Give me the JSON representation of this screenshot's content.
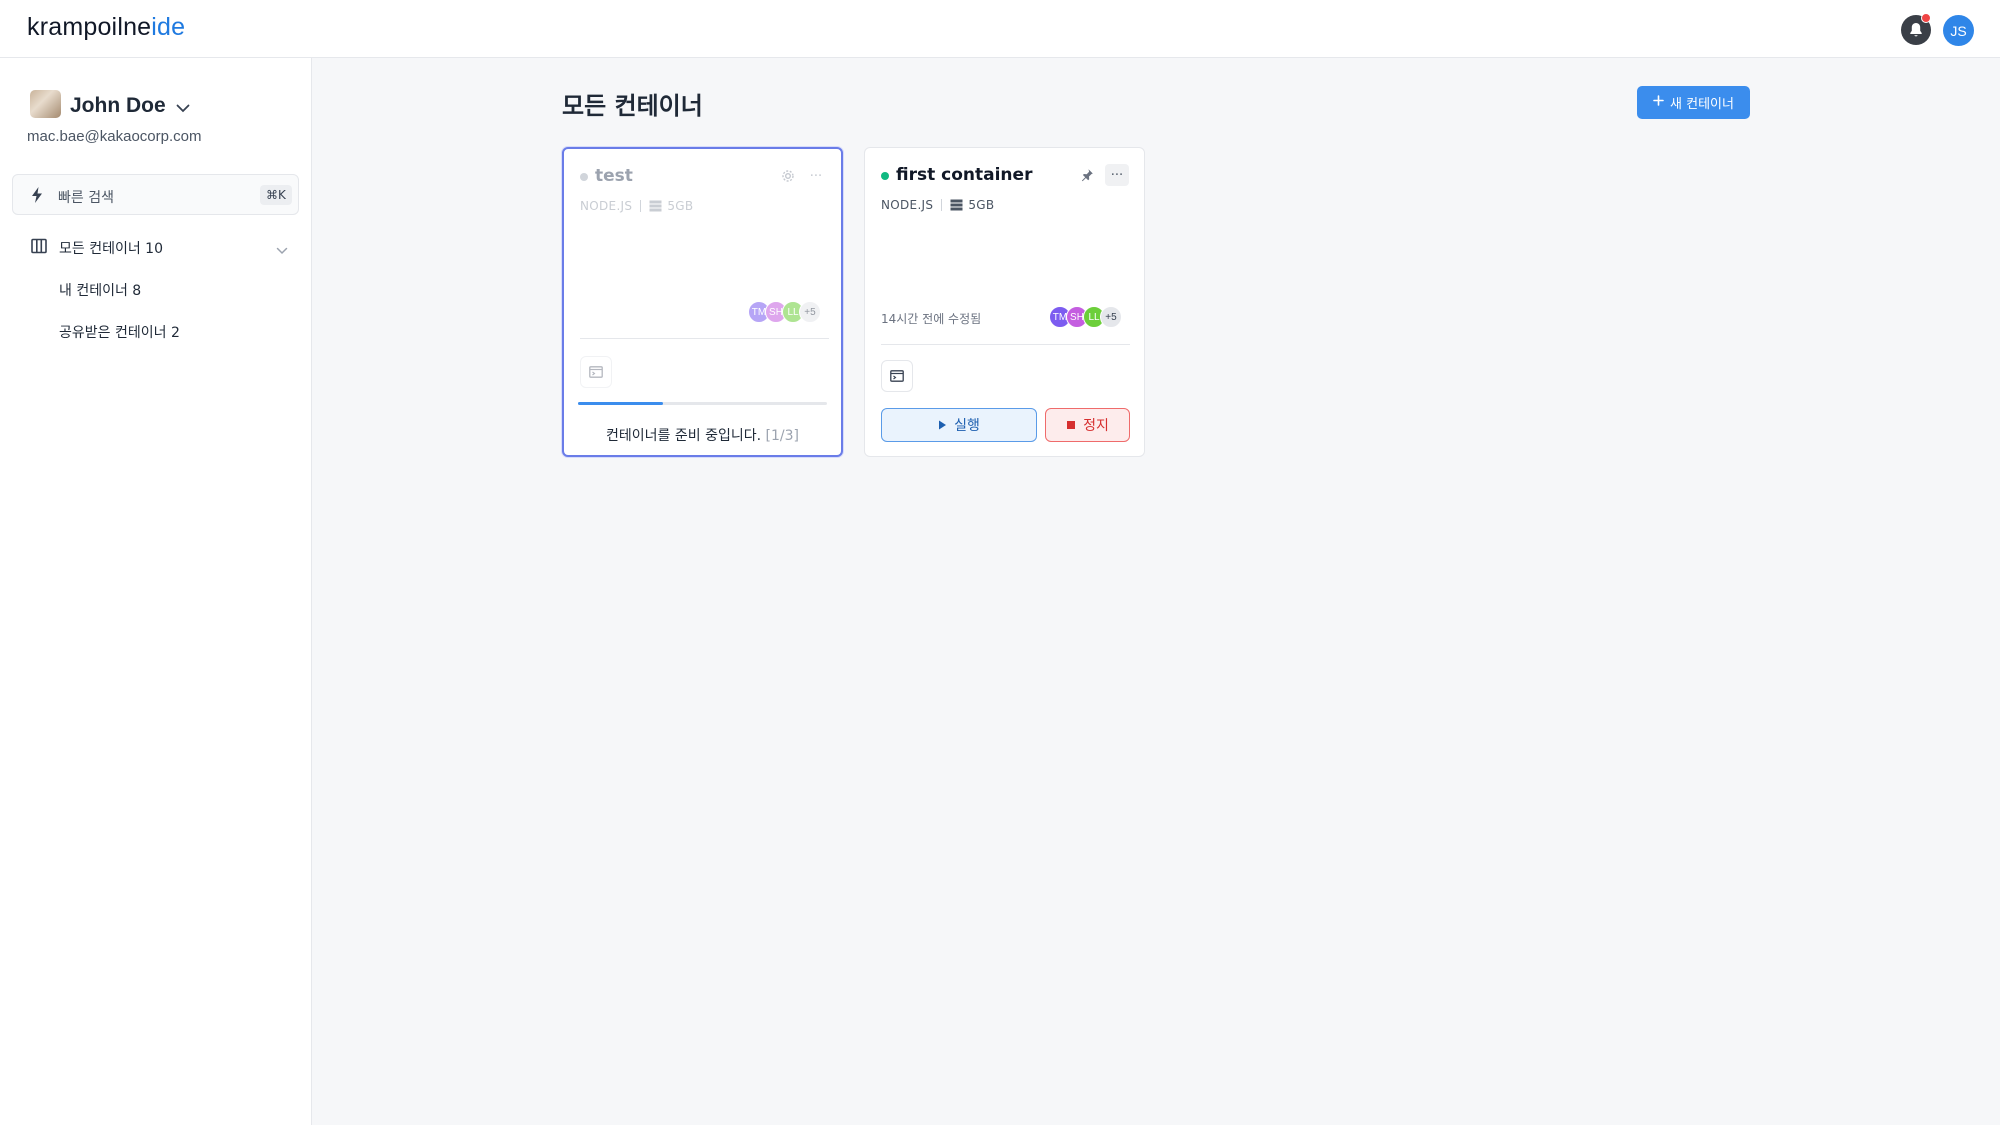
{
  "header": {
    "logo_part1": "krampoilne",
    "logo_part2": "ide",
    "user_initials": "JS",
    "notification_dot_color": "#ef4444",
    "accent_color": "#3b8ded"
  },
  "sidebar": {
    "user_name": "John Doe",
    "user_email": "mac.bae@kakaocorp.com",
    "search_label": "빠른 검색",
    "search_shortcut": "⌘K",
    "nav_main_label": "모든 컨테이너 10",
    "nav_items": [
      {
        "label": "내 컨테이너 8"
      },
      {
        "label": "공유받은 컨테이너 2"
      }
    ]
  },
  "main": {
    "title": "모든 컨테이너",
    "new_button_label": "새 컨테이너",
    "cards": [
      {
        "name": "test",
        "runtime": "NODE.JS",
        "storage": "5GB",
        "status_color": "#d1d5db",
        "members": [
          {
            "initials": "TM",
            "color": "#7c5cf0"
          },
          {
            "initials": "SH",
            "color": "#c45ee0"
          },
          {
            "initials": "LL",
            "color": "#6ccf3a"
          }
        ],
        "members_more": "+5",
        "progress": 0.34,
        "preparing_text": "컨테이너를 준비 중입니다.",
        "preparing_step": "[1/3]"
      },
      {
        "name": "first container",
        "runtime": "NODE.JS",
        "storage": "5GB",
        "status_color": "#10b981",
        "modified": "14시간 전에 수정됨",
        "members": [
          {
            "initials": "TM",
            "color": "#7c5cf0"
          },
          {
            "initials": "SH",
            "color": "#c45ee0"
          },
          {
            "initials": "LL",
            "color": "#6ccf3a"
          }
        ],
        "members_more": "+5",
        "run_label": "실행",
        "stop_label": "정지"
      }
    ]
  }
}
